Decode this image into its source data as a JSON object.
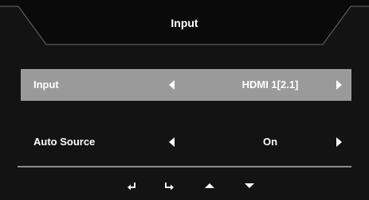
{
  "osd": {
    "title": "Input",
    "colors": {
      "background": "#131313",
      "header": "#0a0a0a",
      "selected_row": "#9a9a9a",
      "divider": "#8c8c8c",
      "text": "#ffffff"
    },
    "rows": [
      {
        "label": "Input",
        "value": "HDMI 1[2.1]",
        "selected": true
      },
      {
        "label": "Auto Source",
        "value": "On",
        "selected": false
      }
    ],
    "nav_keys": [
      {
        "name": "back-icon"
      },
      {
        "name": "enter-icon"
      },
      {
        "name": "up-arrow-icon"
      },
      {
        "name": "down-arrow-icon"
      }
    ]
  }
}
